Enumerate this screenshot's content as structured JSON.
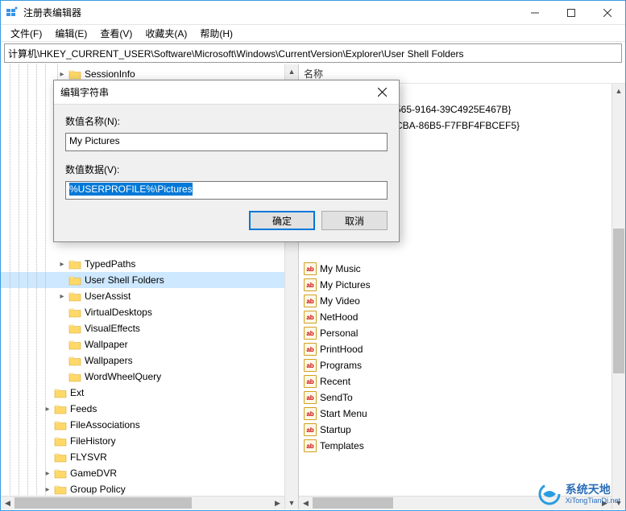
{
  "window": {
    "title": "注册表编辑器"
  },
  "menu": {
    "file": "文件(F)",
    "edit": "编辑(E)",
    "view": "查看(V)",
    "favorites": "收藏夹(A)",
    "help": "帮助(H)"
  },
  "address": "计算机\\HKEY_CURRENT_USER\\Software\\Microsoft\\Windows\\CurrentVersion\\Explorer\\User Shell Folders",
  "list_header": "名称",
  "tree": {
    "visible_items": [
      {
        "indent": 70,
        "exp": "right",
        "label": "SessionInfo"
      },
      {
        "indent": 70,
        "exp": "right",
        "label": "TypedPaths"
      },
      {
        "indent": 70,
        "exp": "none",
        "label": "User Shell Folders",
        "selected": true
      },
      {
        "indent": 70,
        "exp": "right",
        "label": "UserAssist"
      },
      {
        "indent": 70,
        "exp": "none",
        "label": "VirtualDesktops"
      },
      {
        "indent": 70,
        "exp": "none",
        "label": "VisualEffects"
      },
      {
        "indent": 70,
        "exp": "none",
        "label": "Wallpaper"
      },
      {
        "indent": 70,
        "exp": "none",
        "label": "Wallpapers"
      },
      {
        "indent": 70,
        "exp": "none",
        "label": "WordWheelQuery"
      },
      {
        "indent": 52,
        "exp": "none",
        "label": "Ext"
      },
      {
        "indent": 52,
        "exp": "right",
        "label": "Feeds"
      },
      {
        "indent": 52,
        "exp": "none",
        "label": "FileAssociations"
      },
      {
        "indent": 52,
        "exp": "none",
        "label": "FileHistory"
      },
      {
        "indent": 52,
        "exp": "none",
        "label": "FLYSVR"
      },
      {
        "indent": 52,
        "exp": "right",
        "label": "GameDVR"
      },
      {
        "indent": 52,
        "exp": "right",
        "label": "Group Policy"
      }
    ]
  },
  "values_top": [
    "565-9164-39C4925E467B}",
    "CBA-86B5-F7FBF4FBCEF5}"
  ],
  "values_bottom": [
    "My Music",
    "My Pictures",
    "My Video",
    "NetHood",
    "Personal",
    "PrintHood",
    "Programs",
    "Recent",
    "SendTo",
    "Start Menu",
    "Startup",
    "Templates"
  ],
  "dialog": {
    "title": "编辑字符串",
    "name_label": "数值名称(N):",
    "name_value": "My Pictures",
    "data_label": "数值数据(V):",
    "data_value": "%USERPROFILE%\\Pictures",
    "ok": "确定",
    "cancel": "取消"
  },
  "watermark": {
    "cn": "系统天地",
    "url": "XiTongTianDi.net"
  }
}
